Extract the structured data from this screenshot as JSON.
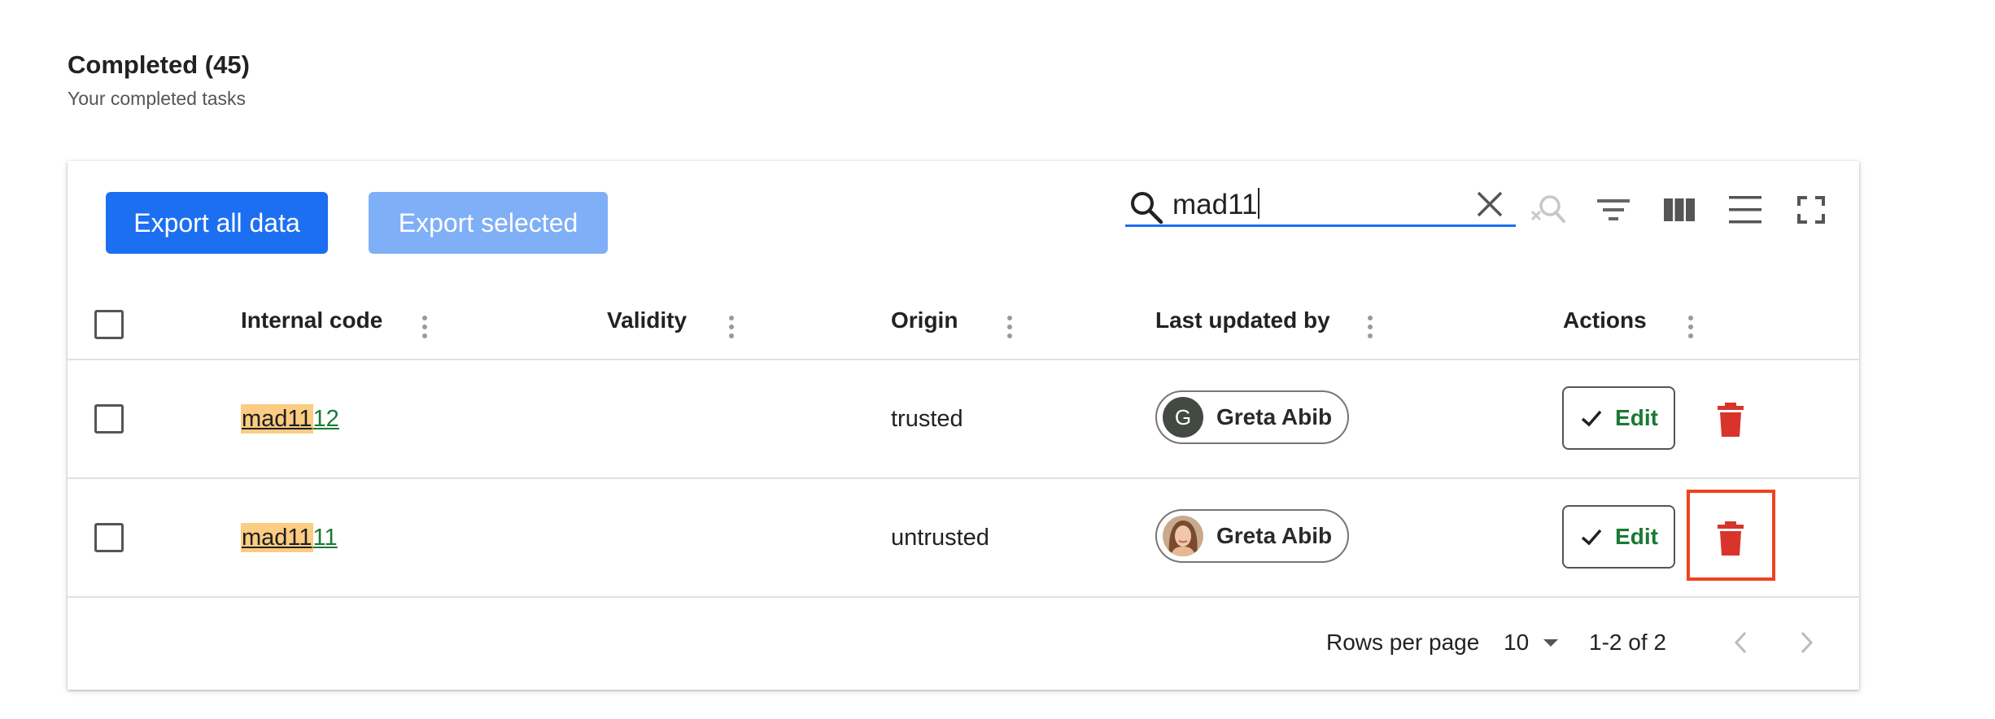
{
  "header": {
    "title": "Completed (45)",
    "subtitle": "Your completed tasks"
  },
  "toolbar": {
    "export_all_label": "Export all data",
    "export_selected_label": "Export selected",
    "search_value": "mad11",
    "icons": [
      "search-icon",
      "clear-icon",
      "clear-search-icon",
      "filter-icon",
      "columns-icon",
      "density-icon",
      "fullscreen-icon"
    ]
  },
  "table": {
    "columns": [
      "Internal code",
      "Validity",
      "Origin",
      "Last updated by",
      "Actions"
    ],
    "rows": [
      {
        "code_match": "mad11",
        "code_rest": "12",
        "validity": "",
        "origin": "trusted",
        "updated_by": "Greta Abib",
        "avatar_letter": "G",
        "edit_label": "Edit"
      },
      {
        "code_match": "mad11",
        "code_rest": "11",
        "validity": "",
        "origin": "untrusted",
        "updated_by": "Greta Abib",
        "avatar_letter": "",
        "edit_label": "Edit"
      }
    ]
  },
  "footer": {
    "rows_per_page_label": "Rows per page",
    "rows_per_page_value": "10",
    "range_label": "1-2 of 2"
  },
  "colors": {
    "primary": "#1d6ff2",
    "primary_disabled": "#7faff7",
    "link_green": "#1a7a34",
    "highlight": "#fbcc82",
    "delete_red": "#d9342b",
    "focus_outline": "#f0421f"
  }
}
